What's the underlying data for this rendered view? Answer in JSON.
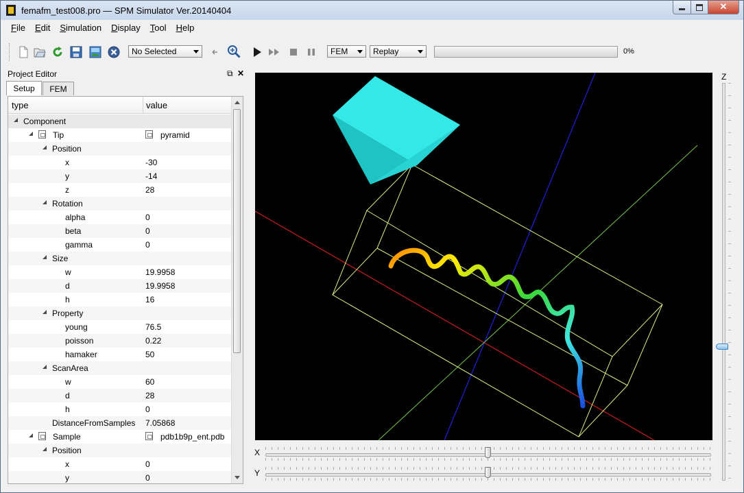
{
  "window": {
    "title": "femafm_test008.pro — SPM Simulator Ver.20140404"
  },
  "menu": [
    {
      "key": "F",
      "rest": "ile"
    },
    {
      "key": "E",
      "rest": "dit"
    },
    {
      "key": "S",
      "rest": "imulation"
    },
    {
      "key": "D",
      "rest": "isplay"
    },
    {
      "key": "T",
      "rest": "ool"
    },
    {
      "key": "H",
      "rest": "elp"
    }
  ],
  "toolbar": {
    "selection_combo": "No Selected",
    "mode_combo": "FEM",
    "replay_combo": "Replay",
    "progress_value": 0,
    "progress_text": "0%",
    "icons": [
      "new-file-icon",
      "open-folder-icon",
      "reload-icon",
      "save-icon",
      "image-icon",
      "close-circle-icon",
      "undo-icon",
      "zoom-icon",
      "play-icon",
      "fast-forward-icon",
      "stop-icon",
      "pause-icon"
    ]
  },
  "dock": {
    "title": "Project Editor",
    "tabs": [
      "Setup",
      "FEM"
    ],
    "columns": [
      "type",
      "value"
    ],
    "rows": [
      {
        "label": "Component",
        "value": "",
        "level": 0,
        "expand": true,
        "icon": false,
        "group": true
      },
      {
        "label": "Tip",
        "value": "pyramid",
        "level": 1,
        "expand": true,
        "icon": true,
        "vicon": true
      },
      {
        "label": "Position",
        "value": "",
        "level": 2,
        "expand": true,
        "icon": false
      },
      {
        "label": "x",
        "value": "-30",
        "level": 3,
        "expand": false,
        "icon": false
      },
      {
        "label": "y",
        "value": "-14",
        "level": 3,
        "expand": false,
        "icon": false
      },
      {
        "label": "z",
        "value": "28",
        "level": 3,
        "expand": false,
        "icon": false
      },
      {
        "label": "Rotation",
        "value": "",
        "level": 2,
        "expand": true,
        "icon": false
      },
      {
        "label": "alpha",
        "value": "0",
        "level": 3,
        "expand": false,
        "icon": false
      },
      {
        "label": "beta",
        "value": "0",
        "level": 3,
        "expand": false,
        "icon": false
      },
      {
        "label": "gamma",
        "value": "0",
        "level": 3,
        "expand": false,
        "icon": false
      },
      {
        "label": "Size",
        "value": "",
        "level": 2,
        "expand": true,
        "icon": false
      },
      {
        "label": "w",
        "value": "19.9958",
        "level": 3,
        "expand": false,
        "icon": false
      },
      {
        "label": "d",
        "value": "19.9958",
        "level": 3,
        "expand": false,
        "icon": false
      },
      {
        "label": "h",
        "value": "16",
        "level": 3,
        "expand": false,
        "icon": false
      },
      {
        "label": "Property",
        "value": "",
        "level": 2,
        "expand": true,
        "icon": false
      },
      {
        "label": "young",
        "value": "76.5",
        "level": 3,
        "expand": false,
        "icon": false
      },
      {
        "label": "poisson",
        "value": "0.22",
        "level": 3,
        "expand": false,
        "icon": false
      },
      {
        "label": "hamaker",
        "value": "50",
        "level": 3,
        "expand": false,
        "icon": false
      },
      {
        "label": "ScanArea",
        "value": "",
        "level": 2,
        "expand": true,
        "icon": false
      },
      {
        "label": "w",
        "value": "60",
        "level": 3,
        "expand": false,
        "icon": false
      },
      {
        "label": "d",
        "value": "28",
        "level": 3,
        "expand": false,
        "icon": false
      },
      {
        "label": "h",
        "value": "0",
        "level": 3,
        "expand": false,
        "icon": false
      },
      {
        "label": "DistanceFromSamples",
        "value": "7.05868",
        "level": 2,
        "expand": false,
        "icon": false
      },
      {
        "label": "Sample",
        "value": "pdb1b9p_ent.pdb",
        "level": 1,
        "expand": true,
        "icon": true,
        "vicon": true
      },
      {
        "label": "Position",
        "value": "",
        "level": 2,
        "expand": true,
        "icon": false
      },
      {
        "label": "x",
        "value": "0",
        "level": 3,
        "expand": false,
        "icon": false
      },
      {
        "label": "y",
        "value": "0",
        "level": 3,
        "expand": false,
        "icon": false
      }
    ]
  },
  "viewport": {
    "background": "#000000",
    "x_axis_color": "#c81e1e",
    "y_axis_color": "#1e1ed2",
    "z_axis_color": "#78c850",
    "tip_color": "#33e6e6",
    "box_color": "#d8f080"
  },
  "sliders": {
    "x": {
      "label": "X",
      "value": 0.5
    },
    "y": {
      "label": "Y",
      "value": 0.5
    },
    "z": {
      "label": "Z",
      "value": 0.5
    }
  }
}
